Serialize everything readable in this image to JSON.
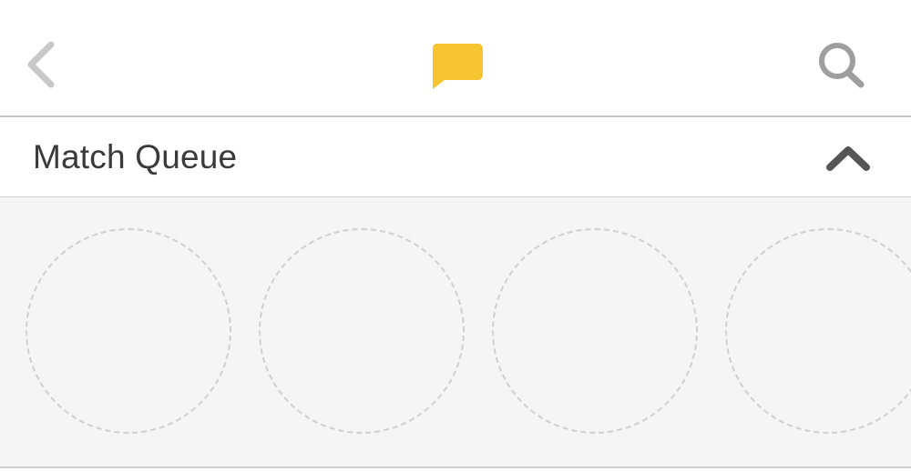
{
  "navbar": {
    "back_icon": "chevron-left-icon",
    "chat_icon": "chat-bubble-icon",
    "search_icon": "search-icon",
    "colors": {
      "back": "#c8c8c8",
      "chat": "#f7c431",
      "search": "#9e9e9e"
    }
  },
  "match_queue": {
    "title": "Match Queue",
    "toggle_icon": "chevron-up-icon",
    "toggle_color": "#555555",
    "slots": [
      {
        "state": "empty"
      },
      {
        "state": "empty"
      },
      {
        "state": "empty"
      },
      {
        "state": "empty"
      }
    ]
  }
}
